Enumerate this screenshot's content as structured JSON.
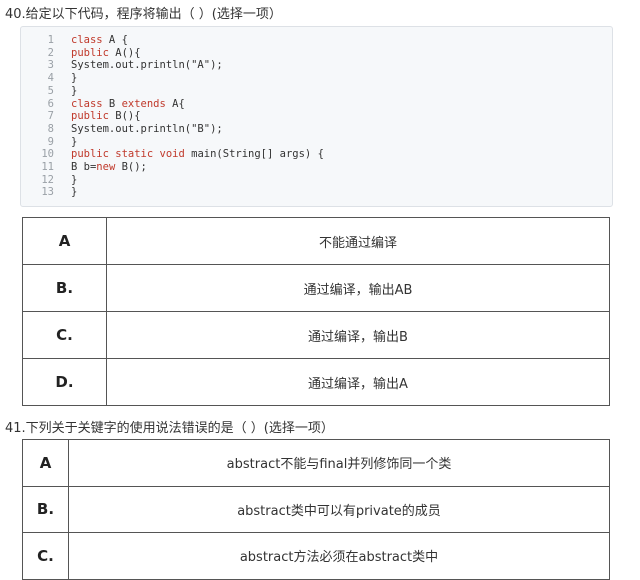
{
  "q40": {
    "title": "40.给定以下代码，程序将输出（ ）(选择一项）",
    "code": [
      {
        "num": "1",
        "segments": [
          {
            "t": "class",
            "kw": true
          },
          {
            "t": " A {",
            "kw": false
          }
        ]
      },
      {
        "num": "2",
        "segments": [
          {
            "t": "public",
            "kw": true
          },
          {
            "t": " A(){",
            "kw": false
          }
        ]
      },
      {
        "num": "3",
        "segments": [
          {
            "t": "System.out.println(\"A\");",
            "kw": false
          }
        ]
      },
      {
        "num": "4",
        "segments": [
          {
            "t": "}",
            "kw": false
          }
        ]
      },
      {
        "num": "5",
        "segments": [
          {
            "t": "}",
            "kw": false
          }
        ]
      },
      {
        "num": "6",
        "segments": [
          {
            "t": "class",
            "kw": true
          },
          {
            "t": " B ",
            "kw": false
          },
          {
            "t": "extends",
            "kw": true
          },
          {
            "t": " A{",
            "kw": false
          }
        ]
      },
      {
        "num": "7",
        "segments": [
          {
            "t": "public",
            "kw": true
          },
          {
            "t": " B(){",
            "kw": false
          }
        ]
      },
      {
        "num": "8",
        "segments": [
          {
            "t": "System.out.println(\"B\");",
            "kw": false
          }
        ]
      },
      {
        "num": "9",
        "segments": [
          {
            "t": "}",
            "kw": false
          }
        ]
      },
      {
        "num": "10",
        "segments": [
          {
            "t": "public",
            "kw": true
          },
          {
            "t": " ",
            "kw": false
          },
          {
            "t": "static",
            "kw": true
          },
          {
            "t": " ",
            "kw": false
          },
          {
            "t": "void",
            "kw": true
          },
          {
            "t": " main(String[] args) {",
            "kw": false
          }
        ]
      },
      {
        "num": "11",
        "segments": [
          {
            "t": "B b=",
            "kw": false
          },
          {
            "t": "new",
            "kw": true
          },
          {
            "t": " B();",
            "kw": false
          }
        ]
      },
      {
        "num": "12",
        "segments": [
          {
            "t": "}",
            "kw": false
          }
        ]
      },
      {
        "num": "13",
        "segments": [
          {
            "t": "}",
            "kw": false
          }
        ]
      }
    ],
    "options": [
      {
        "letter": "A",
        "text": "不能通过编译"
      },
      {
        "letter": "B.",
        "text": "通过编译，输出AB"
      },
      {
        "letter": "C.",
        "text": "通过编译，输出B"
      },
      {
        "letter": "D.",
        "text": "通过编译，输出A"
      }
    ]
  },
  "q41": {
    "title": "41.下列关于关键字的使用说法错误的是（ ）(选择一项）",
    "options": [
      {
        "letter": "A",
        "text": "abstract不能与final并列修饰同一个类"
      },
      {
        "letter": "B.",
        "text": "abstract类中可以有private的成员"
      },
      {
        "letter": "C.",
        "text": "abstract方法必须在abstract类中"
      }
    ]
  },
  "colors": {
    "keyword": "#c0392b",
    "code_bg": "#f6f8fa",
    "line_number": "#9aa0a6",
    "table_border": "#555555"
  }
}
